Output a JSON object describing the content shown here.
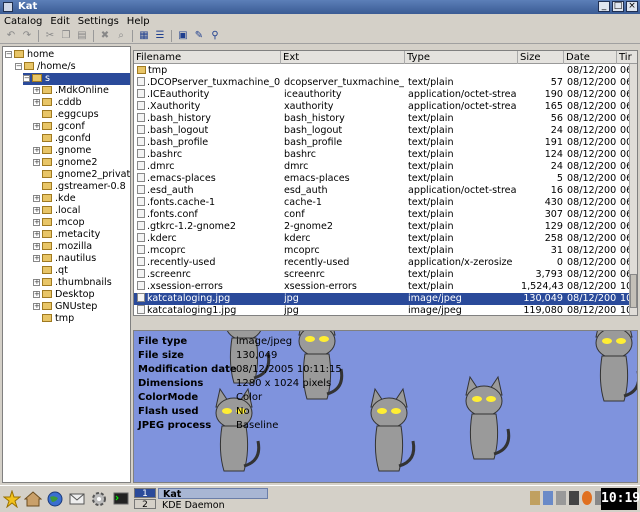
{
  "window": {
    "title": "Kat"
  },
  "menu": [
    "Catalog",
    "Edit",
    "Settings",
    "Help"
  ],
  "toolbar": [
    "undo-icon",
    "redo-icon",
    "cut-icon",
    "copy-icon",
    "paste-icon",
    "delete-icon",
    "find-icon",
    "icon-view-icon",
    "detail-view-icon",
    "catalog-icon",
    "settings-icon",
    "zoom-icon"
  ],
  "tree": {
    "items": [
      {
        "label": "home",
        "level": 0,
        "expander": "−"
      },
      {
        "label": "/home/s",
        "level": 1,
        "expander": "−"
      },
      {
        "label": "s",
        "level": 2,
        "expander": "−",
        "selected": true
      },
      {
        "label": ".MdkOnline",
        "level": 3,
        "expander": "+"
      },
      {
        "label": ".cddb",
        "level": 3,
        "expander": "+"
      },
      {
        "label": ".eggcups",
        "level": 3,
        "expander": ""
      },
      {
        "label": ".gconf",
        "level": 3,
        "expander": "+"
      },
      {
        "label": ".gconfd",
        "level": 3,
        "expander": ""
      },
      {
        "label": ".gnome",
        "level": 3,
        "expander": "+"
      },
      {
        "label": ".gnome2",
        "level": 3,
        "expander": "+"
      },
      {
        "label": ".gnome2_private",
        "level": 3,
        "expander": ""
      },
      {
        "label": ".gstreamer-0.8",
        "level": 3,
        "expander": ""
      },
      {
        "label": ".kde",
        "level": 3,
        "expander": "+"
      },
      {
        "label": ".local",
        "level": 3,
        "expander": "+"
      },
      {
        "label": ".mcop",
        "level": 3,
        "expander": "+"
      },
      {
        "label": ".metacity",
        "level": 3,
        "expander": "+"
      },
      {
        "label": ".mozilla",
        "level": 3,
        "expander": "+"
      },
      {
        "label": ".nautilus",
        "level": 3,
        "expander": "+"
      },
      {
        "label": ".qt",
        "level": 3,
        "expander": ""
      },
      {
        "label": ".thumbnails",
        "level": 3,
        "expander": "+"
      },
      {
        "label": "Desktop",
        "level": 3,
        "expander": "+"
      },
      {
        "label": "GNUstep",
        "level": 3,
        "expander": "+"
      },
      {
        "label": "tmp",
        "level": 3,
        "expander": ""
      }
    ]
  },
  "files": {
    "columns": [
      "Filename",
      "Ext",
      "Type",
      "Size",
      "Date",
      "Tir"
    ],
    "rows": [
      {
        "name": "tmp",
        "ext": "",
        "type": "",
        "size": "",
        "date": "08/12/2005",
        "time": "06",
        "dir": true
      },
      {
        "name": ".DCOPserver_tuxmachine_0",
        "ext": "dcopserver_tuxmachine_0",
        "type": "text/plain",
        "size": "57",
        "date": "08/12/2005",
        "time": "06"
      },
      {
        "name": ".ICEauthority",
        "ext": "iceauthority",
        "type": "application/octet-stream",
        "size": "190",
        "date": "08/12/2005",
        "time": "06"
      },
      {
        "name": ".Xauthority",
        "ext": "xauthority",
        "type": "application/octet-stream",
        "size": "165",
        "date": "08/12/2005",
        "time": "06"
      },
      {
        "name": ".bash_history",
        "ext": "bash_history",
        "type": "text/plain",
        "size": "56",
        "date": "08/12/2005",
        "time": "06"
      },
      {
        "name": ".bash_logout",
        "ext": "bash_logout",
        "type": "text/plain",
        "size": "24",
        "date": "08/12/2005",
        "time": "00"
      },
      {
        "name": ".bash_profile",
        "ext": "bash_profile",
        "type": "text/plain",
        "size": "191",
        "date": "08/12/2005",
        "time": "00"
      },
      {
        "name": ".bashrc",
        "ext": "bashrc",
        "type": "text/plain",
        "size": "124",
        "date": "08/12/2005",
        "time": "00"
      },
      {
        "name": ".dmrc",
        "ext": "dmrc",
        "type": "text/plain",
        "size": "24",
        "date": "08/12/2005",
        "time": "06"
      },
      {
        "name": ".emacs-places",
        "ext": "emacs-places",
        "type": "text/plain",
        "size": "5",
        "date": "08/12/2005",
        "time": "06"
      },
      {
        "name": ".esd_auth",
        "ext": "esd_auth",
        "type": "application/octet-stream",
        "size": "16",
        "date": "08/12/2005",
        "time": "06"
      },
      {
        "name": ".fonts.cache-1",
        "ext": "cache-1",
        "type": "text/plain",
        "size": "430",
        "date": "08/12/2005",
        "time": "06"
      },
      {
        "name": ".fonts.conf",
        "ext": "conf",
        "type": "text/plain",
        "size": "307",
        "date": "08/12/2005",
        "time": "06"
      },
      {
        "name": ".gtkrc-1.2-gnome2",
        "ext": "2-gnome2",
        "type": "text/plain",
        "size": "129",
        "date": "08/12/2005",
        "time": "06"
      },
      {
        "name": ".kderc",
        "ext": "kderc",
        "type": "text/plain",
        "size": "258",
        "date": "08/12/2005",
        "time": "06"
      },
      {
        "name": ".mcoprc",
        "ext": "mcoprc",
        "type": "text/plain",
        "size": "31",
        "date": "08/12/2005",
        "time": "06"
      },
      {
        "name": ".recently-used",
        "ext": "recently-used",
        "type": "application/x-zerosize",
        "size": "0",
        "date": "08/12/2005",
        "time": "06"
      },
      {
        "name": ".screenrc",
        "ext": "screenrc",
        "type": "text/plain",
        "size": "3,793",
        "date": "08/12/2005",
        "time": "06"
      },
      {
        "name": ".xsession-errors",
        "ext": "xsession-errors",
        "type": "text/plain",
        "size": "1,524,432",
        "date": "08/12/2005",
        "time": "10"
      },
      {
        "name": "katcataloging.jpg",
        "ext": "jpg",
        "type": "image/jpeg",
        "size": "130,049",
        "date": "08/12/2005",
        "time": "10",
        "selected": true
      },
      {
        "name": "katcataloging1.jpg",
        "ext": "jpg",
        "type": "image/jpeg",
        "size": "119,080",
        "date": "08/12/2005",
        "time": "10"
      }
    ]
  },
  "preview": {
    "fields": [
      {
        "key": "File type",
        "value": "image/jpeg"
      },
      {
        "key": "File size",
        "value": "130,049"
      },
      {
        "key": "Modification date",
        "value": "08/12/2005  10:11:15"
      },
      {
        "key": "Dimensions",
        "value": "1280 x 1024 pixels"
      },
      {
        "key": "ColorMode",
        "value": "Color"
      },
      {
        "key": "Flash used",
        "value": "No"
      },
      {
        "key": "JPEG process",
        "value": "Baseline"
      }
    ],
    "background_color": "#7f93dd"
  },
  "taskbar": {
    "launchers": [
      "kde-star-icon",
      "home-icon",
      "globe-icon",
      "mail-icon",
      "gear-icon",
      "terminal-icon"
    ],
    "pages": [
      "1",
      "2"
    ],
    "tasks": [
      "Kat",
      "KDE Daemon"
    ],
    "clock": "10:19"
  },
  "colors": {
    "selection": "#2a4a9a",
    "titlebar": "#3a5b94"
  }
}
